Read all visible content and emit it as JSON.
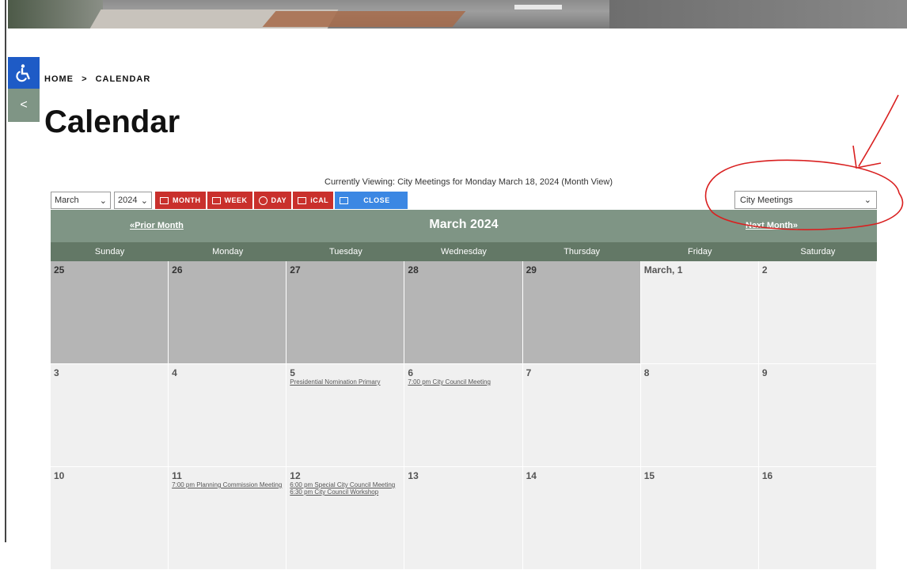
{
  "breadcrumb": {
    "home": "HOME",
    "sep": ">",
    "current": "CALENDAR"
  },
  "page_title": "Calendar",
  "viewing_text": "Currently Viewing: City Meetings for Monday March 18, 2024 (Month View)",
  "toolbar": {
    "month_select": "March",
    "year_select": "2024",
    "month_btn": "MONTH",
    "week_btn": "WEEK",
    "day_btn": "DAY",
    "ical_btn": "iCAL",
    "close_btn": "CLOSE"
  },
  "calendar_select": "City Meetings",
  "calendar": {
    "prior": "«Prior Month",
    "title": "March 2024",
    "next": "Next Month»",
    "days": [
      "Sunday",
      "Monday",
      "Tuesday",
      "Wednesday",
      "Thursday",
      "Friday",
      "Saturday"
    ],
    "weeks": [
      [
        {
          "d": "25",
          "other": true,
          "events": []
        },
        {
          "d": "26",
          "other": true,
          "events": []
        },
        {
          "d": "27",
          "other": true,
          "events": []
        },
        {
          "d": "28",
          "other": true,
          "events": []
        },
        {
          "d": "29",
          "other": true,
          "events": []
        },
        {
          "d": "March, 1",
          "other": false,
          "events": []
        },
        {
          "d": "2",
          "other": false,
          "events": []
        }
      ],
      [
        {
          "d": "3",
          "other": false,
          "events": []
        },
        {
          "d": "4",
          "other": false,
          "events": []
        },
        {
          "d": "5",
          "other": false,
          "events": [
            "Presidential Nomination Primary"
          ]
        },
        {
          "d": "6",
          "other": false,
          "events": [
            "7:00 pm City Council Meeting"
          ]
        },
        {
          "d": "7",
          "other": false,
          "events": []
        },
        {
          "d": "8",
          "other": false,
          "events": []
        },
        {
          "d": "9",
          "other": false,
          "events": []
        }
      ],
      [
        {
          "d": "10",
          "other": false,
          "events": []
        },
        {
          "d": "11",
          "other": false,
          "events": [
            "7:00 pm Planning Commission Meeting"
          ]
        },
        {
          "d": "12",
          "other": false,
          "events": [
            "6:00 pm Special City Council Meeting",
            "6:30 pm City Council Workshop"
          ]
        },
        {
          "d": "13",
          "other": false,
          "events": []
        },
        {
          "d": "14",
          "other": false,
          "events": []
        },
        {
          "d": "15",
          "other": false,
          "events": []
        },
        {
          "d": "16",
          "other": false,
          "events": []
        }
      ]
    ]
  },
  "colors": {
    "header": "#7f9585",
    "dow": "#637866",
    "red_btn": "#c9302c",
    "blue_btn": "#3b87e3",
    "annotation": "#d92020"
  }
}
